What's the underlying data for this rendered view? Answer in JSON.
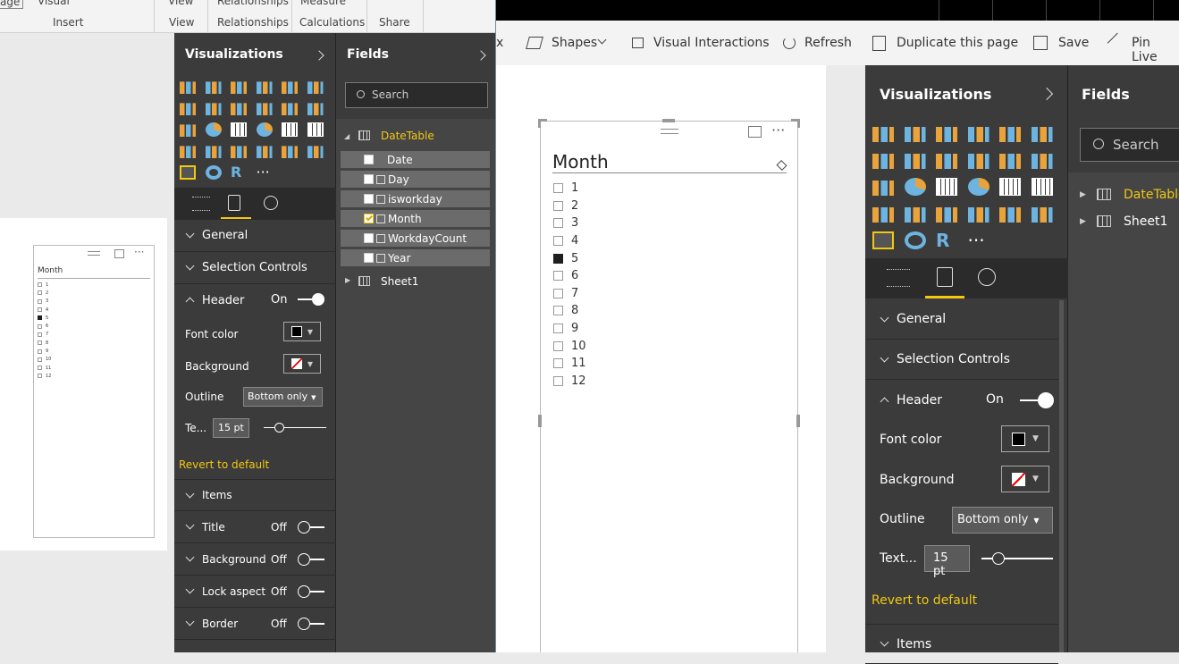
{
  "left_ribbon": {
    "top_items": [
      "age",
      "Visual",
      "View",
      "Relationships",
      "Measure"
    ],
    "groups": [
      "Insert",
      "View",
      "Relationships",
      "Calculations",
      "Share"
    ]
  },
  "right_ribbon": {
    "items": [
      "x",
      "Shapes",
      "Visual Interactions",
      "Refresh",
      "Duplicate this page",
      "Save",
      "Pin Live"
    ]
  },
  "viz_small": {
    "title": "Visualizations",
    "sections": {
      "general": "General",
      "selection": "Selection Controls",
      "header": "Header",
      "header_state": "On",
      "font_color": "Font color",
      "background": "Background",
      "outline": "Outline",
      "outline_value": "Bottom only",
      "text_size": "Te...",
      "text_size_value": "15",
      "unit": "pt",
      "revert": "Revert to default",
      "items": "Items",
      "title_sec": "Title",
      "title_state": "Off",
      "bg_sec": "Background",
      "bg_state": "Off",
      "lock": "Lock aspect",
      "lock_state": "Off",
      "border": "Border",
      "border_state": "Off"
    }
  },
  "fields_small": {
    "title": "Fields",
    "search_placeholder": "Search",
    "table": "DateTable",
    "fields": [
      {
        "name": "Date",
        "checked": false
      },
      {
        "name": "Day",
        "checked": false
      },
      {
        "name": "isworkday",
        "checked": false
      },
      {
        "name": "Month",
        "checked": true
      },
      {
        "name": "WorkdayCount",
        "checked": false
      },
      {
        "name": "Year",
        "checked": false
      }
    ],
    "sheet": "Sheet1"
  },
  "slicer": {
    "header": "Month",
    "items": [
      "1",
      "2",
      "3",
      "4",
      "5",
      "6",
      "7",
      "8",
      "9",
      "10",
      "11",
      "12"
    ],
    "selected": "5"
  },
  "viz_big": {
    "title": "Visualizations",
    "general": "General",
    "selection": "Selection Controls",
    "header": "Header",
    "header_state": "On",
    "font_color": "Font color",
    "background": "Background",
    "outline": "Outline",
    "outline_value": "Bottom only",
    "text_size": "Text...",
    "text_size_value": "15",
    "unit": "pt",
    "revert": "Revert to default",
    "items": "Items"
  },
  "fields_big": {
    "title": "Fields",
    "search_placeholder": "Search",
    "tables": [
      "DateTable",
      "Sheet1"
    ]
  },
  "colors": {
    "accent": "#f2c811",
    "panel": "#3b3b3b",
    "panel_dark": "#2b2b2b"
  }
}
